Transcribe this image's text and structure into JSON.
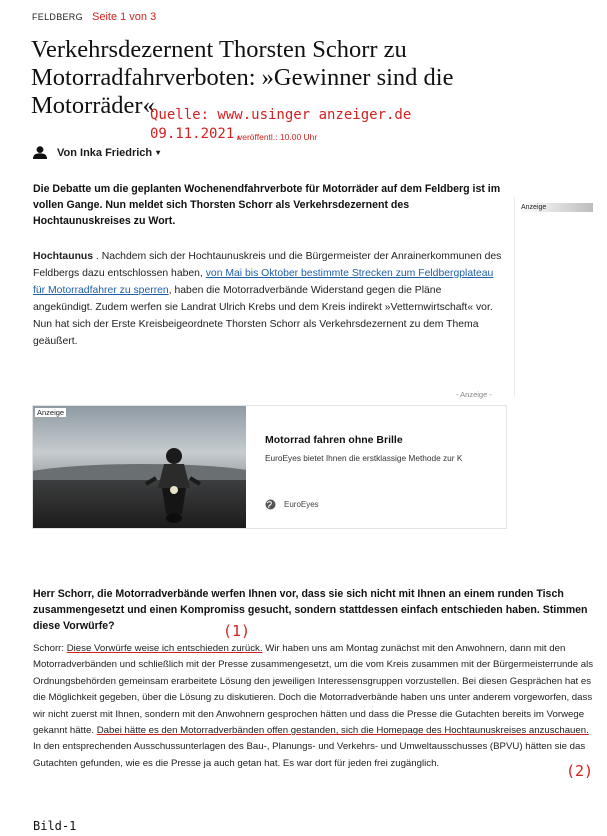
{
  "header": {
    "kicker": "FELDBERG",
    "page_note": "Seite 1 von 3"
  },
  "headline": "Verkehrsdezernent Thorsten Schorr zu Motorradfahrverboten: »Gewinner sind die Motorräder«",
  "source_note": {
    "line1": "Quelle: www.usinger anzeiger.de",
    "date": "09.11.2021,",
    "published": "veröffentl.: 10.00 Uhr"
  },
  "author": {
    "label": "Von Inka Friedrich",
    "icon": "user-icon",
    "caret": "▾"
  },
  "lead": "Die Debatte um die geplanten Wochenendfahrverbote für Motorräder auf dem Feldberg ist im vollen Gange. Nun meldet sich Thorsten Schorr als Verkehrsdezernent des Hochtaunuskreises zu Wort.",
  "side_ad": {
    "label": "Anzeige"
  },
  "body1": {
    "place": "Hochtaunus",
    "text_a": " . Nachdem sich der Hochtaunuskreis und die Bürgermeister der Anrainerkommunen des Feldbergs dazu entschlossen haben, ",
    "link": "von Mai bis Oktober bestimmte Strecken zum Feldbergplateau für Motorradfahrer zu sperren",
    "text_b": ", haben die Motorradverbände Widerstand gegen die Pläne angekündigt. Zudem werfen sie Landrat Ulrich Krebs und dem Kreis indirekt »Vetternwirtschaft« vor. Nun hat sich der Erste Kreisbeigeordnete Thorsten Schorr als Verkehrsdezernent zu dem Thema geäußert."
  },
  "ad_note": "- Anzeige -",
  "ad_card": {
    "label": "Anzeige",
    "title": "Motorrad fahren ohne Brille",
    "description": "EuroEyes bietet Ihnen die erstklassige Methode zur K",
    "brand": "EuroEyes"
  },
  "question": "Herr Schorr, die Motorradverbände werfen Ihnen vor, dass sie sich nicht mit Ihnen an einem runden Tisch zusammengesetzt und einen Kompromiss gesucht, sondern stattdessen einfach entschieden haben. Stimmen diese Vorwürfe?",
  "markers": {
    "m1": "(1)",
    "m2": "(2)"
  },
  "answer": {
    "speaker": "Schorr: ",
    "claim1": "Diese Vorwürfe weise ich entschieden zurück.",
    "text_a": " Wir haben uns am Montag zunächst mit den Anwohnern, dann mit den Motorradverbänden und schließlich mit der Presse zusammengesetzt, um die vom Kreis zusammen mit der Bürgermeisterrunde als Ordnungsbehörden gemeinsam erarbeitete Lösung den jeweiligen Interessensgruppen vorzustellen. Bei diesen Gesprächen hat es die Möglichkeit gegeben, über die Lösung zu diskutieren. Doch die Motorradverbände haben uns unter anderem vorgeworfen, dass wir nicht zuerst mit Ihnen, sondern mit den Anwohnern gesprochen hätten und dass die Presse die Gutachten bereits im Vorwege gekannt hätte. ",
    "claim2": "Dabei hätte es den Motorradverbänden offen gestanden, sich die Homepage des Hochtaunuskreises anzuschauen.",
    "text_b": " In den entsprechenden Ausschussunterlagen des Bau-, Planungs- und Verkehrs- und Umweltausschusses (BPVU) hätten sie das Gutachten gefunden, wie es die Presse ja auch getan hat. Es war dort für jeden frei zugänglich."
  },
  "caption": "Bild-1",
  "colors": {
    "annotation_red": "#d42020",
    "link_blue": "#1f5fa8"
  }
}
